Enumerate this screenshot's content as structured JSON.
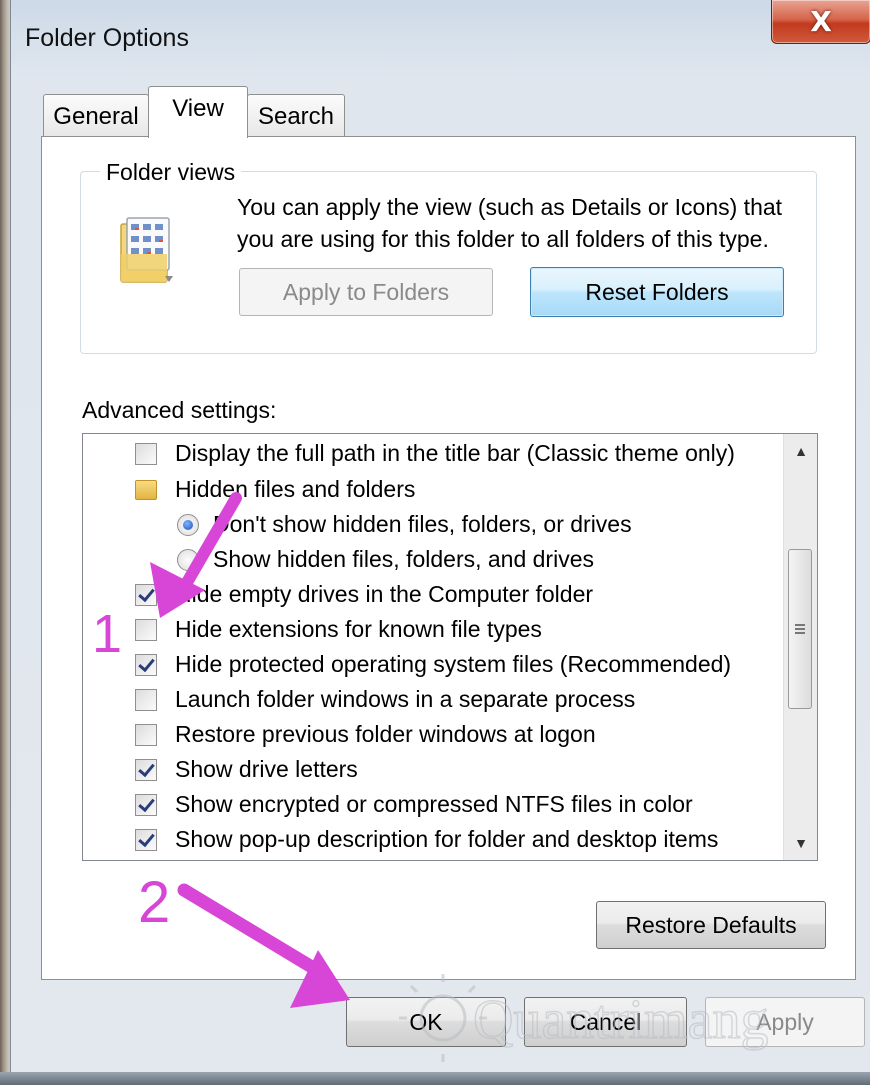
{
  "window": {
    "title": "Folder Options",
    "close_glyph": "X"
  },
  "tabs": [
    {
      "label": "General",
      "selected": false
    },
    {
      "label": "View",
      "selected": true
    },
    {
      "label": "Search",
      "selected": false
    }
  ],
  "folder_views": {
    "group_label": "Folder views",
    "icon": "folder-view-icon",
    "description": "You can apply the view (such as Details or Icons) that you are using for this folder to all folders of this type.",
    "apply_button": "Apply to Folders",
    "apply_button_enabled": false,
    "reset_button": "Reset Folders"
  },
  "advanced": {
    "label": "Advanced settings:",
    "items": [
      {
        "type": "checkbox",
        "checked": false,
        "label": "Display the full path in the title bar (Classic theme only)"
      },
      {
        "type": "folder",
        "label": "Hidden files and folders"
      },
      {
        "type": "radio",
        "selected": true,
        "label": "Don't show hidden files, folders, or drives"
      },
      {
        "type": "radio",
        "selected": false,
        "label": "Show hidden files, folders, and drives"
      },
      {
        "type": "checkbox",
        "checked": true,
        "label": "Hide empty drives in the Computer folder"
      },
      {
        "type": "checkbox",
        "checked": false,
        "label": "Hide extensions for known file types"
      },
      {
        "type": "checkbox",
        "checked": true,
        "label": "Hide protected operating system files (Recommended)"
      },
      {
        "type": "checkbox",
        "checked": false,
        "label": "Launch folder windows in a separate process"
      },
      {
        "type": "checkbox",
        "checked": false,
        "label": "Restore previous folder windows at logon"
      },
      {
        "type": "checkbox",
        "checked": true,
        "label": "Show drive letters"
      },
      {
        "type": "checkbox",
        "checked": true,
        "label": "Show encrypted or compressed NTFS files in color"
      },
      {
        "type": "checkbox",
        "checked": true,
        "label": "Show pop-up description for folder and desktop items"
      }
    ],
    "scroll_up_glyph": "▲",
    "scroll_down_glyph": "▼"
  },
  "restore_defaults_button": "Restore Defaults",
  "dialog_buttons": {
    "ok": "OK",
    "cancel": "Cancel",
    "apply": "Apply",
    "apply_enabled": false
  },
  "annotations": {
    "marker_1": "1",
    "marker_2": "2",
    "arrow_color": "#d846d8"
  },
  "watermark": {
    "text": "Quantrimang"
  },
  "colors": {
    "title_bar": "#cdd9e6",
    "close_button": "#c23a1e",
    "reset_button_border": "#3c7fb1"
  }
}
